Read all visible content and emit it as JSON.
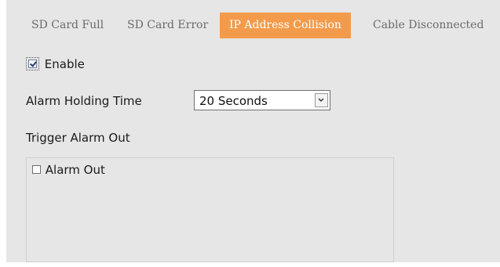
{
  "tabs": [
    {
      "label": "SD Card Full",
      "active": false
    },
    {
      "label": "SD Card Error",
      "active": false
    },
    {
      "label": "IP Address Collision",
      "active": true
    },
    {
      "label": "Cable Disconnected",
      "active": false
    }
  ],
  "enable": {
    "label": "Enable",
    "checked": true
  },
  "alarm_holding_time": {
    "label": "Alarm Holding Time",
    "selected": "20 Seconds"
  },
  "trigger_alarm_out": {
    "label": "Trigger Alarm Out"
  },
  "alarm_out": {
    "label": "Alarm Out",
    "checked": false
  },
  "colors": {
    "active_tab": "#f39b4b",
    "panel_background": "#e6e6e6",
    "inactive_tab_text": "#6b6b6b"
  }
}
